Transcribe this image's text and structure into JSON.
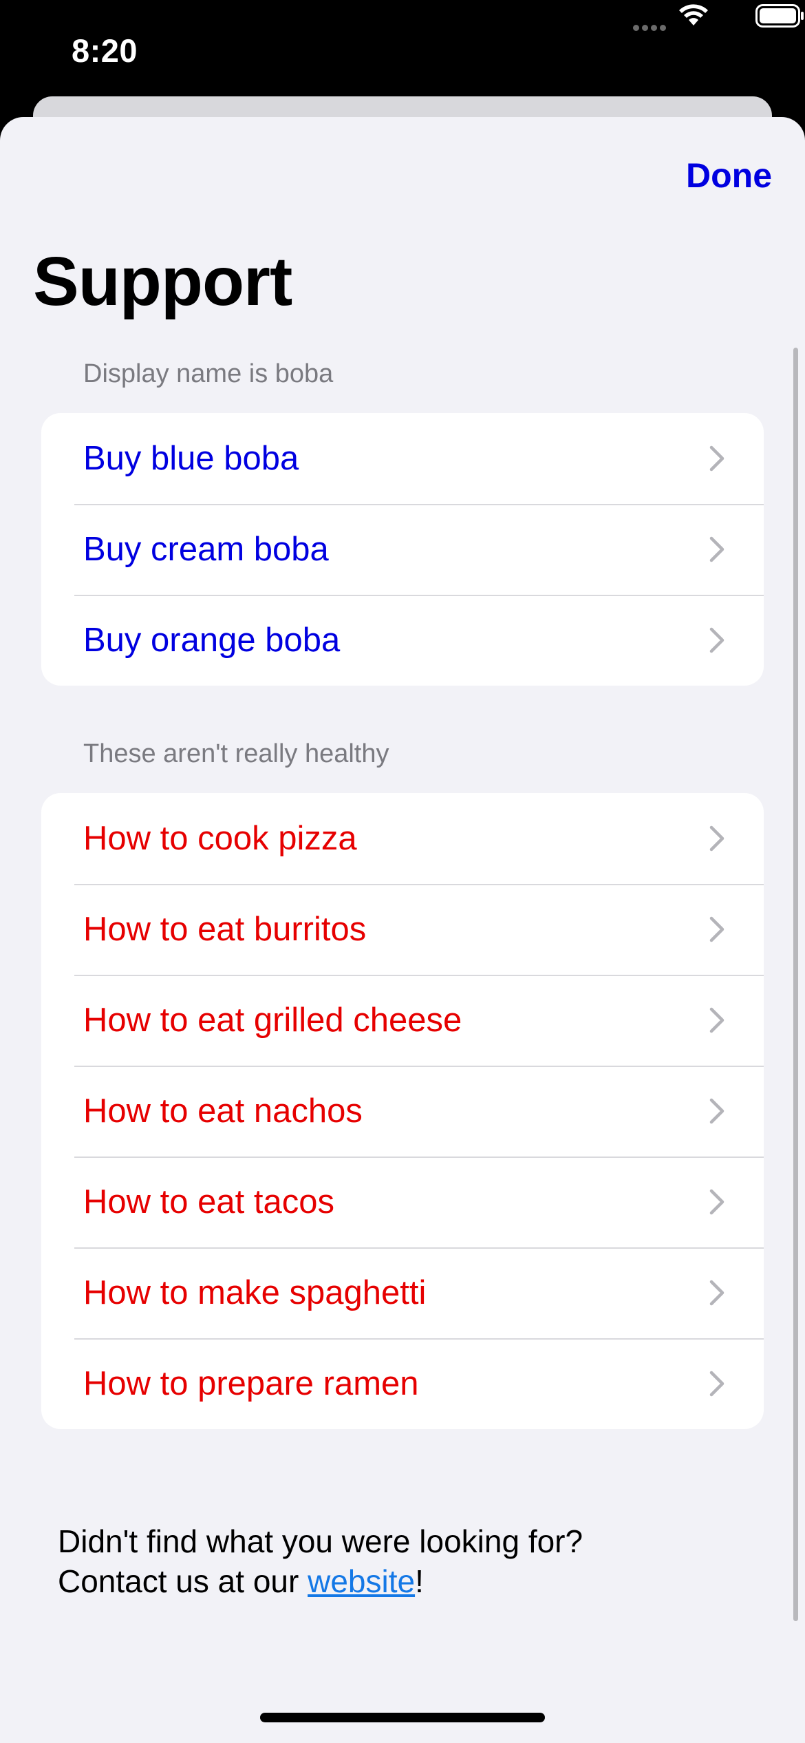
{
  "status_bar": {
    "time": "8:20"
  },
  "header": {
    "done_label": "Done",
    "title": "Support"
  },
  "sections": [
    {
      "header": "Display name is boba",
      "color": "#0000e0",
      "items": [
        "Buy blue boba",
        "Buy cream boba",
        "Buy orange boba"
      ]
    },
    {
      "header": "These aren't really healthy",
      "color": "#e60000",
      "items": [
        "How to cook pizza",
        "How to eat burritos",
        "How to eat grilled cheese",
        "How to eat nachos",
        "How to eat tacos",
        "How to make spaghetti",
        "How to prepare ramen"
      ]
    }
  ],
  "footer": {
    "line1": "Didn't find what you were looking for?",
    "line2_prefix": "Contact us at our ",
    "link_text": "website",
    "line2_suffix": "!"
  },
  "icons": {
    "row_accessory": "chevron-right-icon",
    "wifi": "wifi-icon",
    "battery": "battery-icon"
  }
}
